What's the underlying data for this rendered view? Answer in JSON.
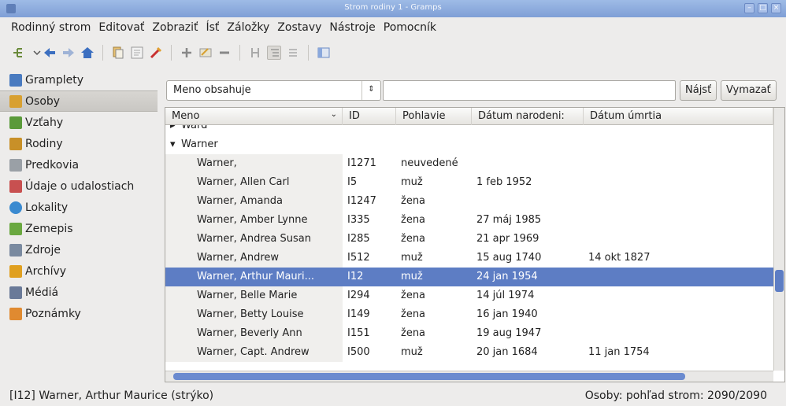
{
  "window": {
    "title": "Strom rodiny 1 - Gramps"
  },
  "menu": [
    "Rodinný strom",
    "Editovať",
    "Zobraziť",
    "Ísť",
    "Záložky",
    "Zostavy",
    "Nástroje",
    "Pomocník"
  ],
  "toolbar": {
    "icons": [
      "tree-view-icon",
      "dropdown-icon",
      "back-icon",
      "forward-icon",
      "home-icon",
      "copy-icon",
      "edit-icon",
      "tools-icon",
      "add-icon",
      "edit-person-icon",
      "remove-icon",
      "merge-icon",
      "tree-toggle-icon",
      "list-toggle-icon",
      "sidebar-icon"
    ]
  },
  "sidebar": {
    "items": [
      {
        "label": "Gramplety",
        "icon": "gramplets-icon",
        "color": "#4a7bc0"
      },
      {
        "label": "Osoby",
        "icon": "people-icon",
        "color": "#d8a030",
        "active": true
      },
      {
        "label": "Vzťahy",
        "icon": "relationships-icon",
        "color": "#5a9a3a"
      },
      {
        "label": "Rodiny",
        "icon": "families-icon",
        "color": "#c89028"
      },
      {
        "label": "Predkovia",
        "icon": "ancestry-icon",
        "color": "#9aa0a6"
      },
      {
        "label": "Údaje o udalostiach",
        "icon": "events-icon",
        "color": "#c85050"
      },
      {
        "label": "Lokality",
        "icon": "places-icon",
        "color": "#3a8ad0"
      },
      {
        "label": "Zemepis",
        "icon": "geography-icon",
        "color": "#6aa840"
      },
      {
        "label": "Zdroje",
        "icon": "sources-icon",
        "color": "#7a8aa0"
      },
      {
        "label": "Archívy",
        "icon": "repositories-icon",
        "color": "#e0a020"
      },
      {
        "label": "Médiá",
        "icon": "media-icon",
        "color": "#6a7a98"
      },
      {
        "label": "Poznámky",
        "icon": "notes-icon",
        "color": "#e08a30"
      }
    ]
  },
  "filter": {
    "combo_value": "Meno obsahuje",
    "search_value": "",
    "find_label": "Nájsť",
    "clear_label": "Vymazať"
  },
  "table": {
    "columns": [
      "Meno",
      "ID",
      "Pohlavie",
      "Dátum narodeni:",
      "Dátum úmrtia"
    ],
    "rows": [
      {
        "type": "group",
        "expander": "▸",
        "name": "Ward"
      },
      {
        "type": "group",
        "expander": "▾",
        "name": "Warner"
      },
      {
        "name": "Warner,",
        "id": "I1271",
        "gender": "neuvedené",
        "birth": "",
        "death": ""
      },
      {
        "name": "Warner, Allen Carl",
        "id": "I5",
        "gender": "muž",
        "birth": "1 feb 1952",
        "death": ""
      },
      {
        "name": "Warner, Amanda",
        "id": "I1247",
        "gender": "žena",
        "birth": "",
        "death": ""
      },
      {
        "name": "Warner, Amber Lynne",
        "id": "I335",
        "gender": "žena",
        "birth": "27 máj 1985",
        "death": ""
      },
      {
        "name": "Warner, Andrea Susan",
        "id": "I285",
        "gender": "žena",
        "birth": "21 apr 1969",
        "death": ""
      },
      {
        "name": "Warner, Andrew",
        "id": "I512",
        "gender": "muž",
        "birth": "15 aug 1740",
        "death": "14 okt 1827"
      },
      {
        "name": "Warner, Arthur Mauri...",
        "id": "I12",
        "gender": "muž",
        "birth": "24 jan 1954",
        "death": "",
        "selected": true
      },
      {
        "name": "Warner, Belle Marie",
        "id": "I294",
        "gender": "žena",
        "birth": "14 júl 1974",
        "death": ""
      },
      {
        "name": "Warner, Betty Louise",
        "id": "I149",
        "gender": "žena",
        "birth": "16 jan 1940",
        "death": ""
      },
      {
        "name": "Warner, Beverly Ann",
        "id": "I151",
        "gender": "žena",
        "birth": "19 aug 1947",
        "death": ""
      },
      {
        "name": "Warner, Capt. Andrew",
        "id": "I500",
        "gender": "muž",
        "birth": "20 jan 1684",
        "death": "11 jan 1754"
      }
    ]
  },
  "status": {
    "left": "[I12] Warner, Arthur Maurice (strýko)",
    "right": "Osoby: pohľad strom: 2090/2090"
  },
  "colors": {
    "selection": "#5d7dc4",
    "titlebar": "#8aa8dc"
  }
}
